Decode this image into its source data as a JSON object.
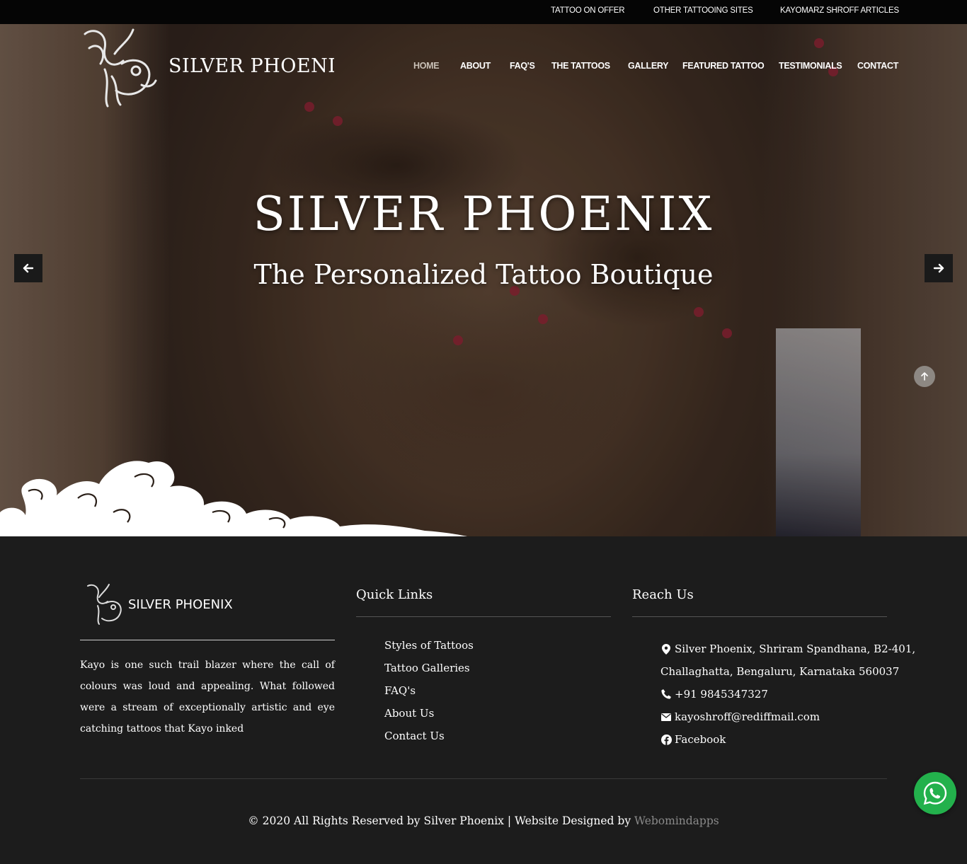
{
  "topbar": {
    "links": [
      "TATTOO ON OFFER",
      "OTHER TATTOOING SITES",
      "KAYOMARZ SHROFF ARTICLES"
    ]
  },
  "header": {
    "logo_text": "SILVER PHOENIX",
    "nav": [
      "HOME",
      "ABOUT",
      "FAQ'S",
      "THE TATTOOS",
      "GALLERY",
      "FEATURED TATTOO",
      "TESTIMONIALS",
      "CONTACT"
    ],
    "active_nav": "HOME"
  },
  "hero": {
    "title": "SILVER PHOENIX",
    "subtitle": "The Personalized Tattoo Boutique",
    "prev_icon": "arrow-left-icon",
    "next_icon": "arrow-right-icon",
    "scroll_icon": "arrow-up-icon"
  },
  "footer": {
    "logo_text": "SILVER PHOENIX",
    "about": "Kayo is one such trail blazer where the call of colours was loud and appealing. What followed were a stream of exceptionally artistic and eye catching tattoos that Kayo inked",
    "quick_links": {
      "heading": "Quick Links",
      "items": [
        "Styles of Tattoos",
        "Tattoo Galleries",
        "FAQ's",
        "About Us",
        "Contact Us"
      ]
    },
    "reach_us": {
      "heading": "Reach Us",
      "address_line1": "Silver Phoenix, Shriram Spandhana, B2-401,",
      "address_line2": "Challaghatta, Bengaluru, Karnataka 560037",
      "phone": "+91 9845347327",
      "email": "kayoshroff@rediffmail.com",
      "facebook": "Facebook"
    },
    "copyright": "© 2020 All Rights Reserved by Silver Phoenix | Website Designed by",
    "credit": "Webomindapps"
  },
  "colors": {
    "topbar_bg": "#050505",
    "footer_bg": "#1c1c1c",
    "whatsapp": "#23b14c",
    "credit": "#8a8a8a"
  }
}
